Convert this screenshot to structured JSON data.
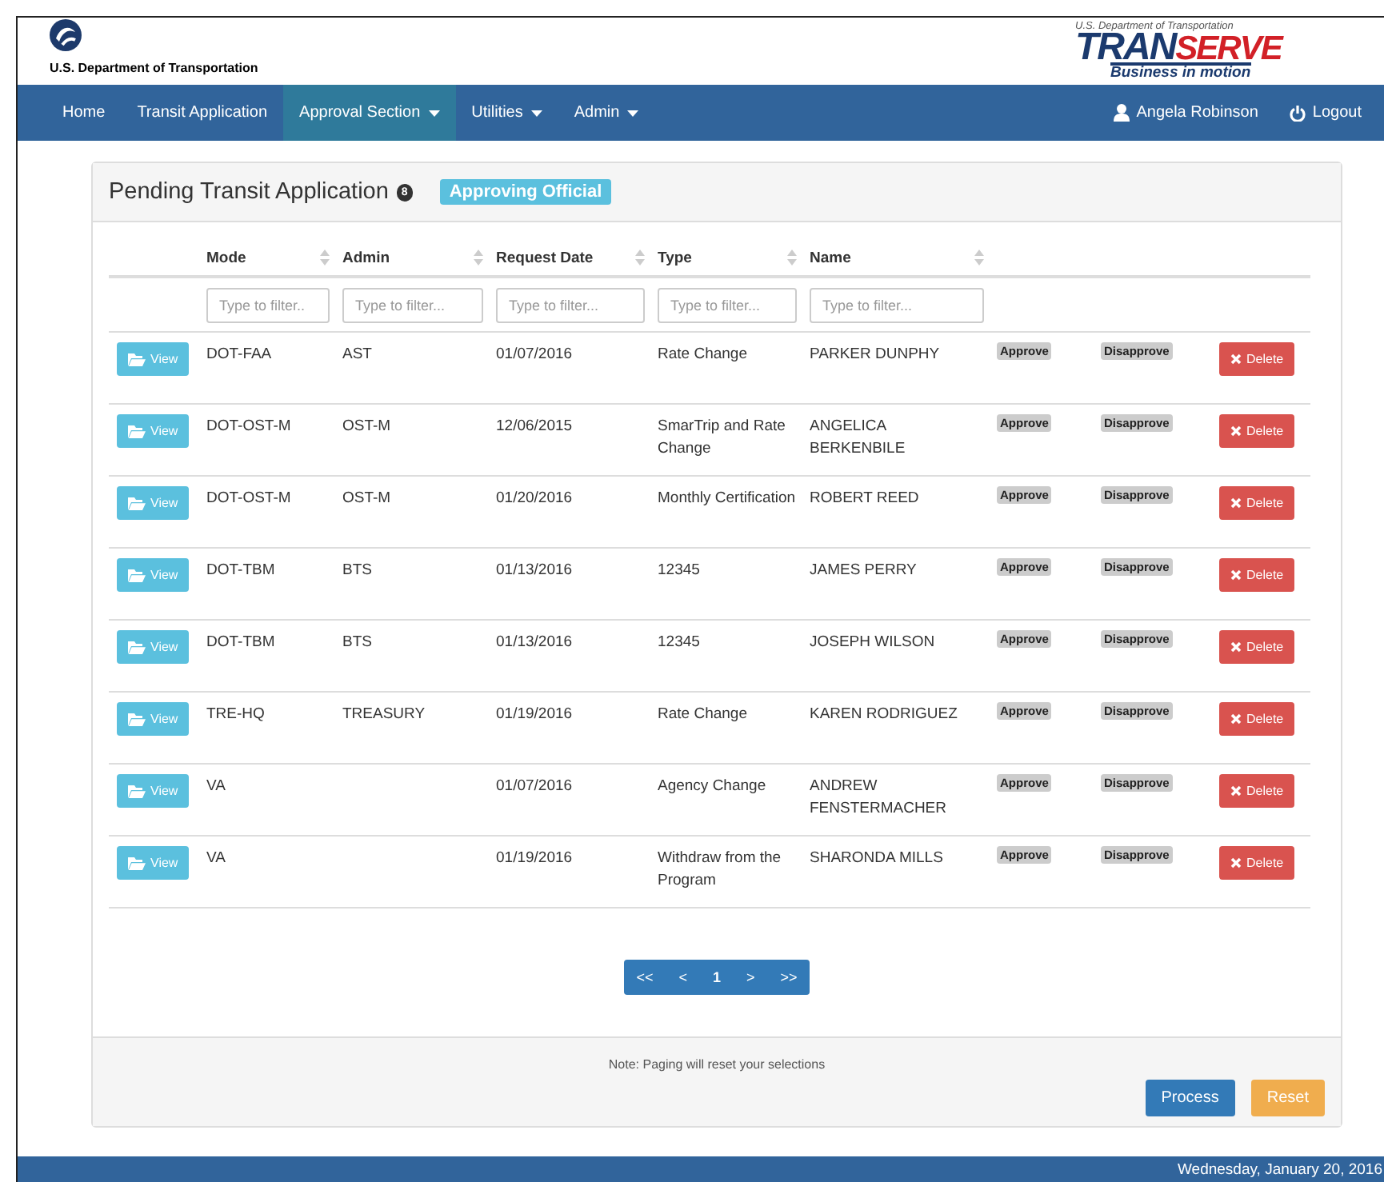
{
  "header": {
    "agency": "U.S. Department of Transportation",
    "brand": {
      "top_line": "U.S. Department of Transportation",
      "name_parts": [
        {
          "text": "TRAN",
          "kind": "dark"
        },
        {
          "text": "SERVE",
          "kind": "accent"
        }
      ],
      "tagline": "Business in motion"
    }
  },
  "nav": {
    "items": [
      {
        "label": "Home",
        "selected": false,
        "dropdown": false
      },
      {
        "label": "Transit Application",
        "selected": false,
        "dropdown": false
      },
      {
        "label": "Approval Section",
        "selected": true,
        "dropdown": true
      },
      {
        "label": "Utilities",
        "selected": false,
        "dropdown": true
      },
      {
        "label": "Admin",
        "selected": false,
        "dropdown": true
      }
    ],
    "user": "Angela Robinson",
    "logout": "Logout"
  },
  "panel": {
    "title": "Pending Transit Application",
    "count": "8",
    "role_badge": "Approving Official",
    "columns": [
      "Mode",
      "Admin",
      "Request Date",
      "Type",
      "Name"
    ],
    "filters": [
      {
        "placeholder": "Type to filter.."
      },
      {
        "placeholder": "Type to filter..."
      },
      {
        "placeholder": "Type to filter..."
      },
      {
        "placeholder": "Type to filter..."
      },
      {
        "placeholder": "Type to filter..."
      }
    ],
    "rows": [
      {
        "view": "View",
        "mode": "DOT-FAA",
        "admin": "AST",
        "request_date": "01/07/2016",
        "type": "Rate Change",
        "name": "PARKER DUNPHY",
        "approve": "Approve",
        "disapprove": "Disapprove",
        "delete": "Delete"
      },
      {
        "view": "View",
        "mode": "DOT-OST-M",
        "admin": "OST-M",
        "request_date": "12/06/2015",
        "type": "SmarTrip and Rate Change",
        "name": "ANGELICA BERKENBILE",
        "approve": "Approve",
        "disapprove": "Disapprove",
        "delete": "Delete"
      },
      {
        "view": "View",
        "mode": "DOT-OST-M",
        "admin": "OST-M",
        "request_date": "01/20/2016",
        "type": "Monthly Certification",
        "name": "ROBERT REED",
        "approve": "Approve",
        "disapprove": "Disapprove",
        "delete": "Delete"
      },
      {
        "view": "View",
        "mode": "DOT-TBM",
        "admin": "BTS",
        "request_date": "01/13/2016",
        "type": "12345",
        "name": "JAMES PERRY",
        "approve": "Approve",
        "disapprove": "Disapprove",
        "delete": "Delete"
      },
      {
        "view": "View",
        "mode": "DOT-TBM",
        "admin": "BTS",
        "request_date": "01/13/2016",
        "type": "12345",
        "name": "JOSEPH WILSON",
        "approve": "Approve",
        "disapprove": "Disapprove",
        "delete": "Delete"
      },
      {
        "view": "View",
        "mode": "TRE-HQ",
        "admin": "TREASURY",
        "request_date": "01/19/2016",
        "type": "Rate Change",
        "name": "KAREN RODRIGUEZ",
        "approve": "Approve",
        "disapprove": "Disapprove",
        "delete": "Delete"
      },
      {
        "view": "View",
        "mode": "VA",
        "admin": "",
        "request_date": "01/07/2016",
        "type": "Agency Change",
        "name": "ANDREW FENSTERMACHER",
        "approve": "Approve",
        "disapprove": "Disapprove",
        "delete": "Delete"
      },
      {
        "view": "View",
        "mode": "VA",
        "admin": "",
        "request_date": "01/19/2016",
        "type": "Withdraw from the Program",
        "name": "SHARONDA MILLS",
        "approve": "Approve",
        "disapprove": "Disapprove",
        "delete": "Delete"
      }
    ],
    "pagination": [
      {
        "label": "<<",
        "selected": false
      },
      {
        "label": "<",
        "selected": false
      },
      {
        "label": "1",
        "selected": true
      },
      {
        "label": ">",
        "selected": false
      },
      {
        "label": ">>",
        "selected": false
      }
    ],
    "note": "Note: Paging will reset your selections",
    "buttons": [
      {
        "label": "Process",
        "kind": "primary"
      },
      {
        "label": "Reset",
        "kind": "warning"
      }
    ]
  },
  "footer": {
    "date": "Wednesday, January 20, 2016"
  }
}
